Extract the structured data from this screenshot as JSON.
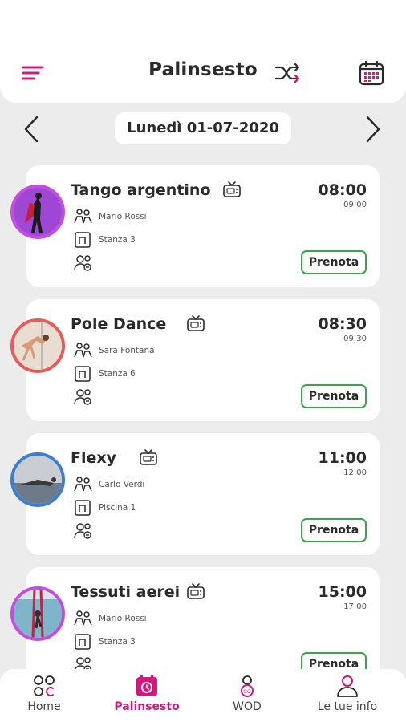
{
  "header": {
    "title": "Palinsesto",
    "menu_icon": "menu-icon",
    "shuffle_icon": "shuffle-icon",
    "calendar_icon": "calendar-icon"
  },
  "date_nav": {
    "date": "Lunedì 01-07-2020",
    "prev_icon": "chevron-left-icon",
    "next_icon": "chevron-right-icon"
  },
  "colors": {
    "accent": "#d1187d",
    "book_border": "#3aa548",
    "background": "#ececec",
    "card": "#ffffff"
  },
  "classes": [
    {
      "title": "Tango argentino",
      "start": "08:00",
      "end": "09:00",
      "instructor": "Mario Rossi",
      "room": "Stanza 3",
      "book_label": "Prenota",
      "avatar_border": "#c44de0"
    },
    {
      "title": "Pole Dance",
      "start": "08:30",
      "end": "09:30",
      "instructor": "Sara Fontana",
      "room": "Stanza 6",
      "book_label": "Prenota",
      "avatar_border": "#e85b5b"
    },
    {
      "title": "Flexy",
      "start": "11:00",
      "end": "12:00",
      "instructor": "Carlo Verdi",
      "room": "Piscina 1",
      "book_label": "Prenota",
      "avatar_border": "#3c7fd0"
    },
    {
      "title": "Tessuti aerei",
      "start": "15:00",
      "end": "17:00",
      "instructor": "Mario Rossi",
      "room": "Stanza 3",
      "book_label": "Prenota",
      "avatar_border": "#c44de0"
    }
  ],
  "bottom_nav": [
    {
      "label": "Home",
      "icon": "home-grid-icon",
      "active": false
    },
    {
      "label": "Palinsesto",
      "icon": "calendar-clock-icon",
      "active": true
    },
    {
      "label": "WOD",
      "icon": "wod-icon",
      "active": false
    },
    {
      "label": "Le tue info",
      "icon": "user-icon",
      "active": false
    }
  ]
}
